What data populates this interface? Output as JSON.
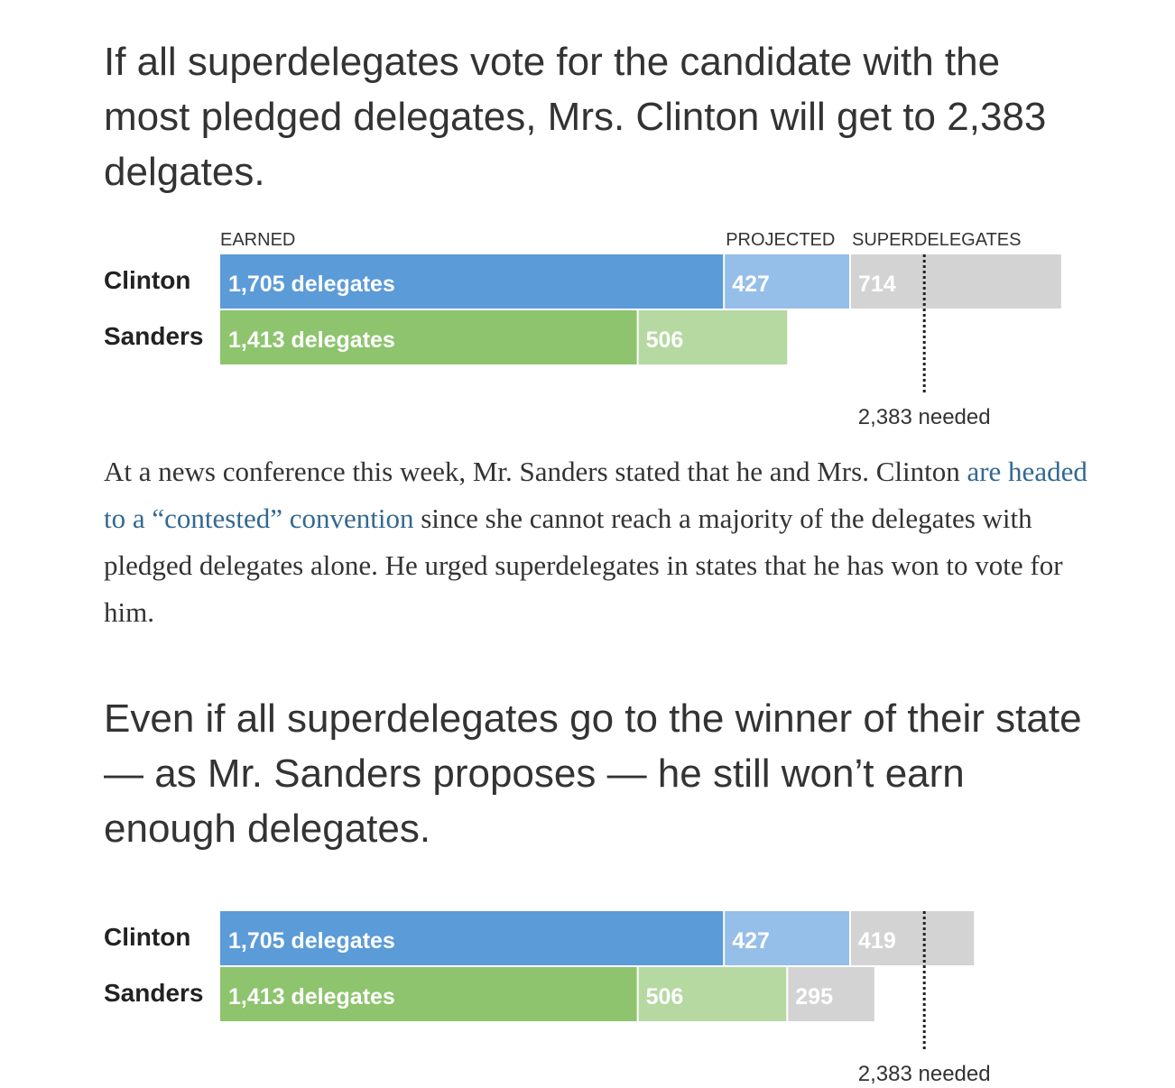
{
  "headline_1": "If all superdelegates vote for the candidate with the most pledged delegates, Mrs. Clinton will get to 2,383 delgates.",
  "paragraph": {
    "before_link": "At a news conference this week, Mr. Sanders stated that he and Mrs. Clinton ",
    "link_text": "are headed to a “contested” convention",
    "after_link": " since she cannot reach a majority of the delegates with pledged delegates alone. He urged superdelegates in states that he has won to vote for him."
  },
  "headline_2": "Even if all superdelegates go to the winner of their state — as Mr. Sanders proposes — he still won’t earn enough delegates.",
  "colors": {
    "clinton_earned": "#5b9bd8",
    "clinton_projected": "#95bee8",
    "sanders_earned": "#8dc46d",
    "sanders_projected": "#b5d9a1",
    "superdelegates": "#d3d3d3"
  },
  "chart_data": [
    {
      "type": "bar",
      "orientation": "horizontal",
      "stacked": true,
      "column_labels": [
        "EARNED",
        "PROJECTED",
        "SUPERDELEGATES"
      ],
      "categories": [
        "Clinton",
        "Sanders"
      ],
      "series": [
        {
          "name": "EARNED",
          "values": [
            1705,
            1413
          ],
          "labels": [
            "1,705 delegates",
            "1,413 delegates"
          ]
        },
        {
          "name": "PROJECTED",
          "values": [
            427,
            506
          ],
          "labels": [
            "427",
            "506"
          ]
        },
        {
          "name": "SUPERDELEGATES",
          "values": [
            714,
            0
          ],
          "labels": [
            "714",
            ""
          ]
        }
      ],
      "threshold": {
        "value": 2383,
        "label": "2,383 needed"
      },
      "xlim": [
        0,
        2850
      ]
    },
    {
      "type": "bar",
      "orientation": "horizontal",
      "stacked": true,
      "column_labels": [
        "",
        "",
        ""
      ],
      "categories": [
        "Clinton",
        "Sanders"
      ],
      "series": [
        {
          "name": "EARNED",
          "values": [
            1705,
            1413
          ],
          "labels": [
            "1,705 delegates",
            "1,413 delegates"
          ]
        },
        {
          "name": "PROJECTED",
          "values": [
            427,
            506
          ],
          "labels": [
            "427",
            "506"
          ]
        },
        {
          "name": "SUPERDELEGATES",
          "values": [
            419,
            295
          ],
          "labels": [
            "419",
            "295"
          ]
        }
      ],
      "threshold": {
        "value": 2383,
        "label": "2,383 needed"
      },
      "xlim": [
        0,
        2850
      ]
    }
  ]
}
